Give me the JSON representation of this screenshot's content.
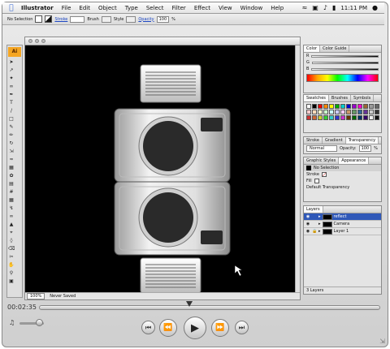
{
  "menubar": {
    "app_name": "Illustrator",
    "items": [
      "File",
      "Edit",
      "Object",
      "Type",
      "Select",
      "Filter",
      "Effect",
      "View",
      "Window",
      "Help"
    ],
    "clock": "11:11 PM",
    "icons": [
      "apple-icon",
      "wifi-icon",
      "display-icon",
      "volume-icon",
      "battery-icon",
      "spotlight-icon"
    ]
  },
  "control_bar": {
    "selection": "No Selection",
    "stroke_label": "Stroke",
    "brush_label": "Brush",
    "style_label": "Style",
    "opacity_label": "Opacity",
    "opacity_value": "100",
    "percent": "%"
  },
  "document": {
    "zoom": "100%",
    "status": "Never Saved"
  },
  "color_palette": {
    "tabs": [
      "Color",
      "Color Guide"
    ],
    "channels": [
      "R",
      "G",
      "B"
    ]
  },
  "swatches_palette": {
    "tabs": [
      "Swatches",
      "Brushes",
      "Symbols"
    ]
  },
  "stroke_palette": {
    "tabs": [
      "Stroke",
      "Gradient",
      "Transparency"
    ],
    "blend_mode": "Normal",
    "opacity_label": "Opacity:",
    "opacity_value": "100",
    "percent": "%"
  },
  "appearance_palette": {
    "tabs": [
      "Graphic Styles",
      "Appearance"
    ],
    "selection": "No Selection",
    "rows": [
      "Stroke",
      "Fill",
      "Default Transparency"
    ]
  },
  "layers_palette": {
    "tabs": [
      "Layers"
    ],
    "layers": [
      "reflect",
      "Camera",
      "Layer 1"
    ],
    "count": "3 Layers"
  },
  "quicktime": {
    "time": "00:02:35",
    "playhead_fraction": 0.44
  },
  "colors": {
    "canvas_bg": "#000000",
    "selection_blue": "#2f58b8",
    "camera_body": "#e8e8e8",
    "lens": "#2a2a2a"
  }
}
